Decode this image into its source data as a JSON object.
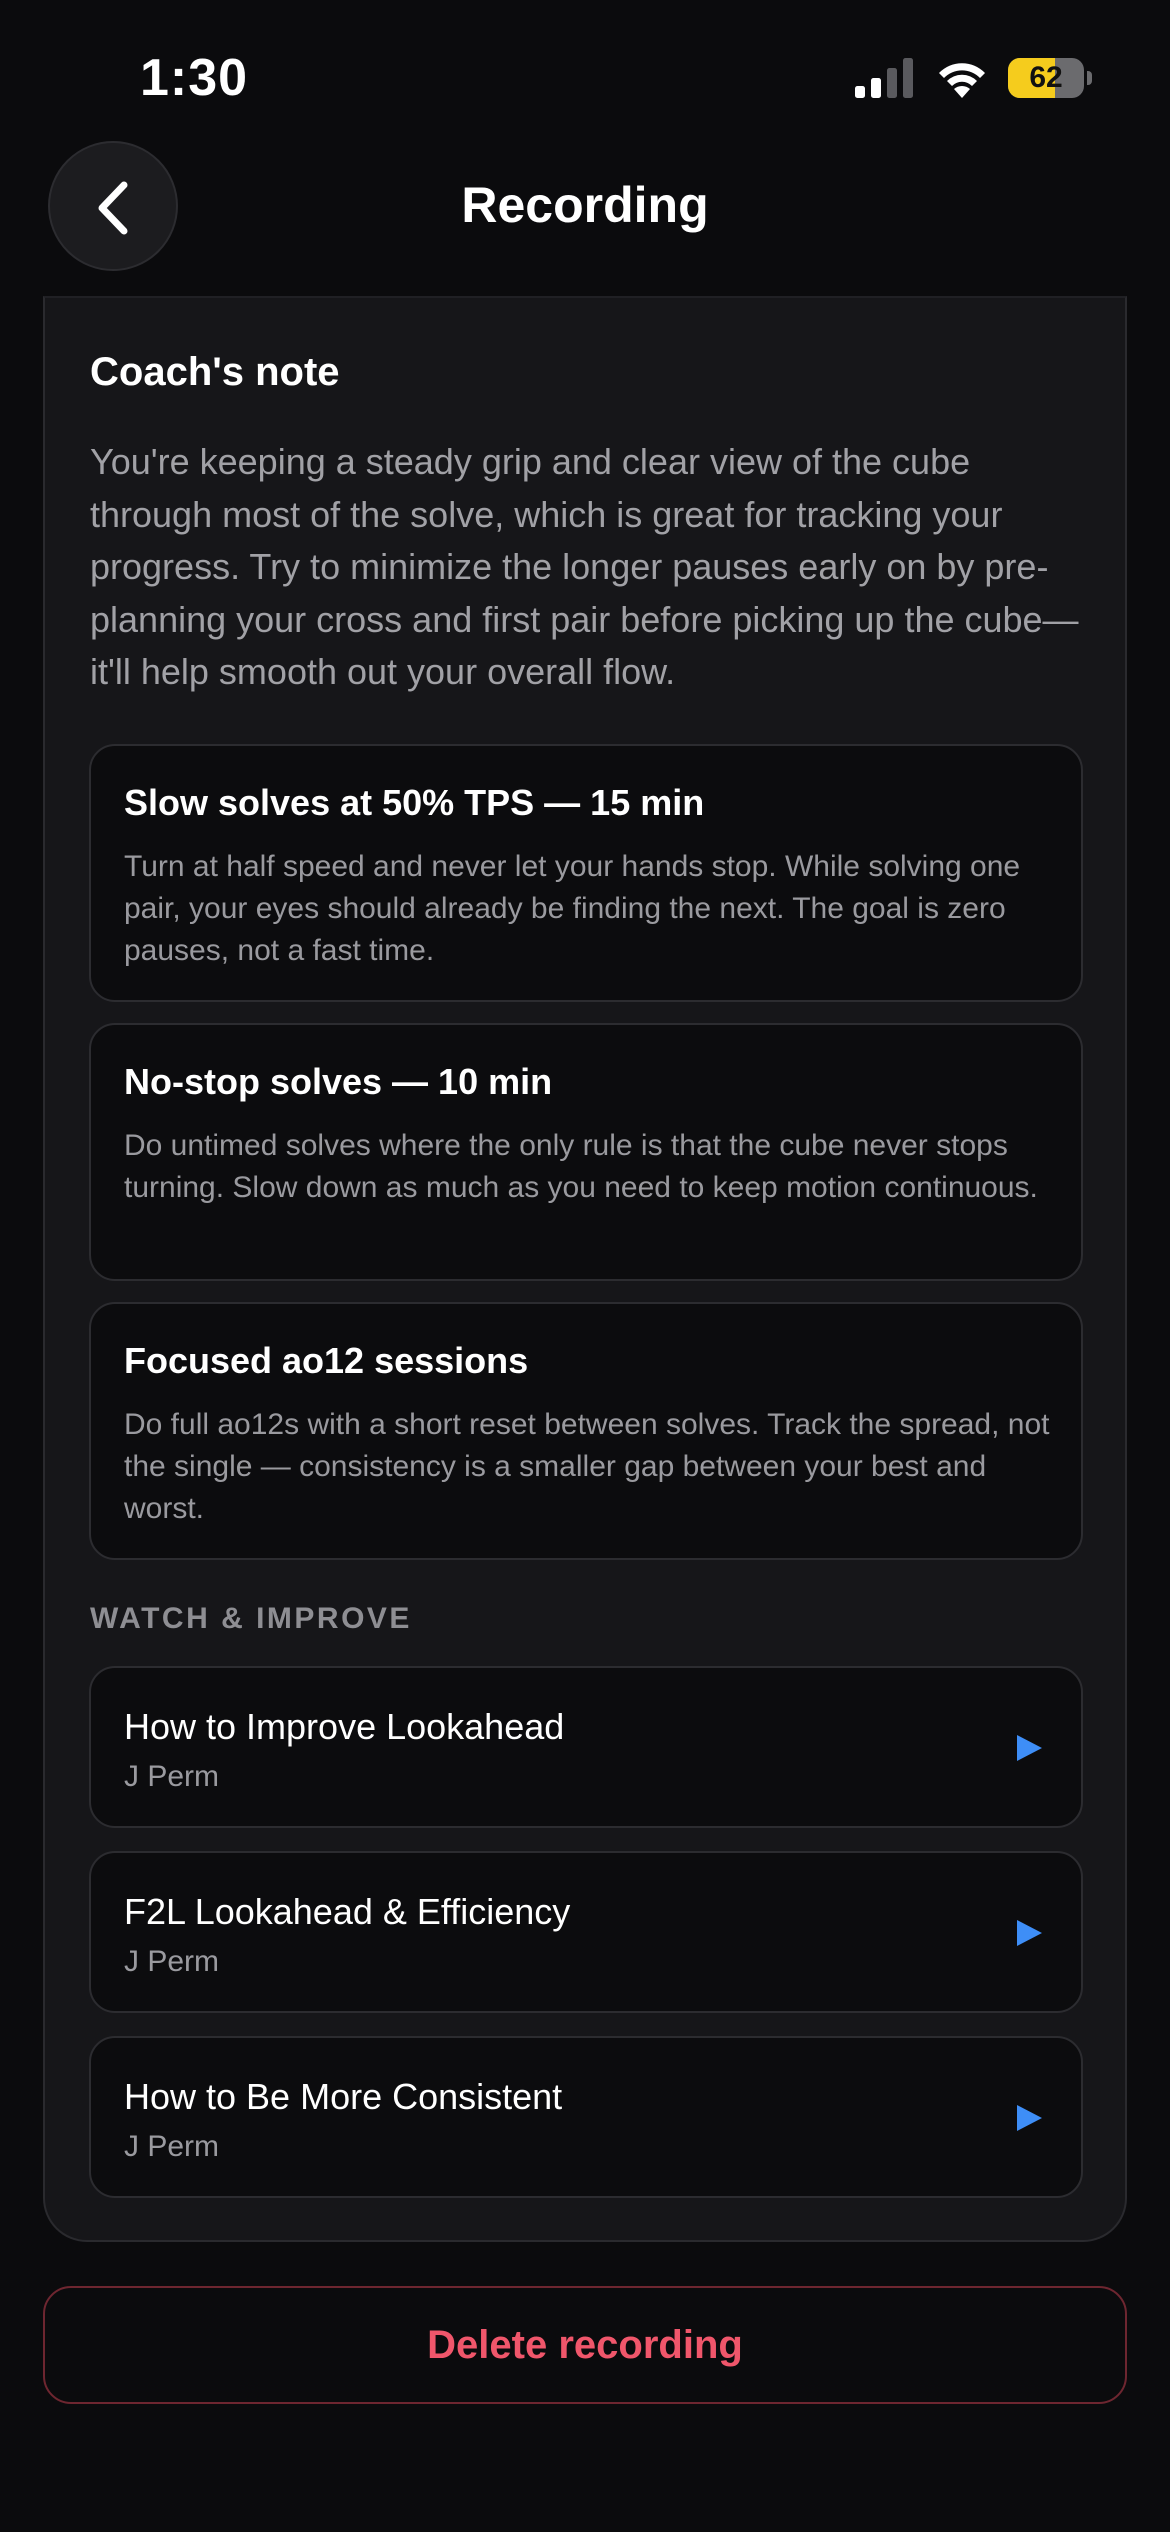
{
  "status_bar": {
    "time": "1:30",
    "battery_level": "62",
    "battery_fraction": 0.62,
    "battery_color": "#f5cc1d",
    "signal_bars_active": 2,
    "signal_bars_total": 4
  },
  "header": {
    "title": "Recording",
    "back_icon": "chevron-left-icon"
  },
  "coach": {
    "heading": "Coach's note",
    "text": "You're keeping a steady grip and clear view of the cube through most of the solve, which is great for tracking your progress. Try to minimize the longer pauses early on by pre-planning your cross and first pair before picking up the cube—it'll help smooth out your overall flow."
  },
  "tips": [
    {
      "title": "Slow solves at 50% TPS — 15 min",
      "body": "Turn at half speed and never let your hands stop. While solving one pair, your eyes should already be finding the next. The goal is zero pauses, not a fast time."
    },
    {
      "title": "No-stop solves — 10 min",
      "body": "Do untimed solves where the only rule is that the cube never stops turning. Slow down as much as you need to keep motion continuous."
    },
    {
      "title": "Focused ao12 sessions",
      "body": "Do full ao12s with a short reset between solves. Track the spread, not the single — consistency is a smaller gap between your best and worst."
    }
  ],
  "watch": {
    "label": "WATCH & IMPROVE",
    "videos": [
      {
        "title": "How to Improve Lookahead",
        "author": "J Perm",
        "icon": "play-icon"
      },
      {
        "title": "F2L Lookahead & Efficiency",
        "author": "J Perm",
        "icon": "play-icon"
      },
      {
        "title": "How to Be More Consistent",
        "author": "J Perm",
        "icon": "play-icon"
      }
    ]
  },
  "actions": {
    "delete_label": "Delete recording"
  },
  "colors": {
    "accent_blue": "#3e8ef7",
    "danger": "#f0566b",
    "background": "#0b0b0d",
    "card": "#161619"
  }
}
